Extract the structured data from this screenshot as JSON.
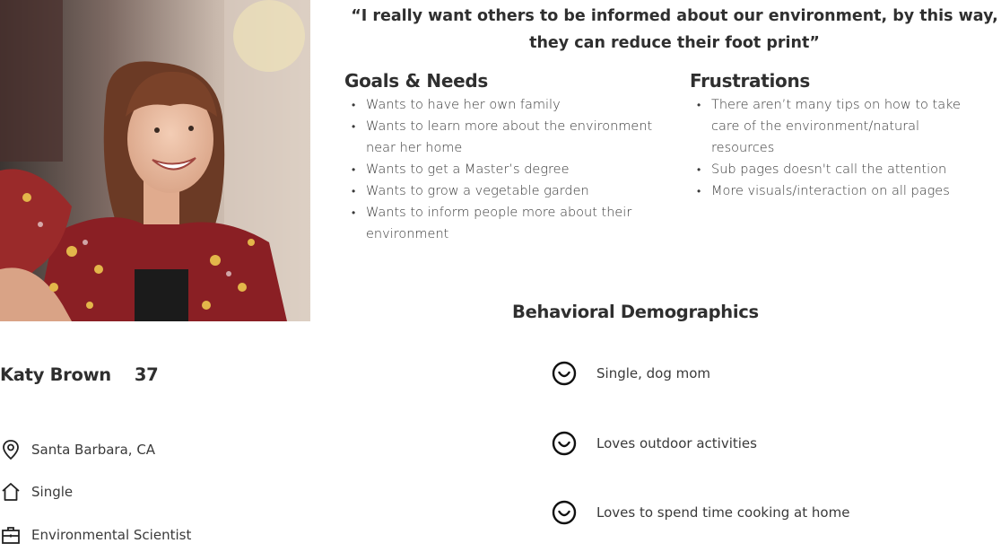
{
  "quote": "“I really want others to be informed about our environment, by this way, they can reduce their foot print”",
  "goals": {
    "title": "Goals & Needs",
    "items": [
      "Wants to have her own family",
      "Wants to learn more about the environment near her home",
      "Wants to get a Master’s degree",
      "Wants to grow a vegetable garden",
      "Wants to inform people more about their environment"
    ]
  },
  "frustrations": {
    "title": "Frustrations",
    "items": [
      "There aren’t many tips on how to take care of the environment/natural resources",
      "Sub pages doesn't call the attention",
      "More visuals/interaction on all pages"
    ]
  },
  "behavioral": {
    "title": "Behavioral Demographics",
    "items": [
      {
        "icon": "smile-icon",
        "label": "Single, dog mom"
      },
      {
        "icon": "smile-icon",
        "label": "Loves outdoor activities"
      },
      {
        "icon": "smile-icon",
        "label": "Loves to spend time cooking at home"
      }
    ]
  },
  "persona": {
    "name": "Katy Brown",
    "age": "37",
    "location": {
      "icon": "location-pin-icon",
      "label": "Santa Barbara, CA"
    },
    "status": {
      "icon": "home-icon",
      "label": "Single"
    },
    "occupation": {
      "icon": "briefcase-icon",
      "label": "Environmental Scientist"
    }
  },
  "photo": {
    "description_icon": "persona-photo"
  }
}
